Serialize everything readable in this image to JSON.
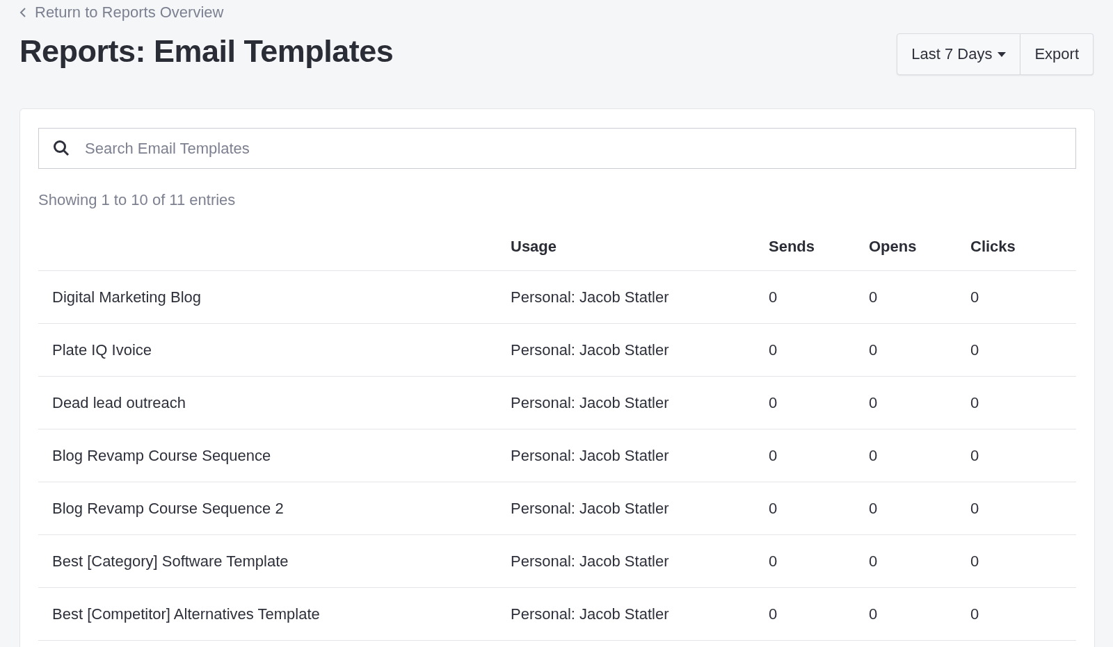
{
  "back_link": "Return to Reports Overview",
  "title": "Reports: Email Templates",
  "buttons": [
    {
      "label": "Last 7 Days",
      "kind": "dropdown"
    },
    {
      "label": "Export",
      "kind": "plain"
    }
  ],
  "search": {
    "placeholder": "Search Email Templates"
  },
  "entries_info": "Showing 1 to 10 of 11 entries",
  "table": {
    "columns": [
      "",
      "Usage",
      "Sends",
      "Opens",
      "Clicks"
    ],
    "rows": [
      [
        "Digital Marketing Blog",
        "Personal: Jacob Statler",
        "0",
        "0",
        "0"
      ],
      [
        "Plate IQ Ivoice",
        "Personal: Jacob Statler",
        "0",
        "0",
        "0"
      ],
      [
        "Dead lead outreach",
        "Personal: Jacob Statler",
        "0",
        "0",
        "0"
      ],
      [
        "Blog Revamp Course Sequence",
        "Personal: Jacob Statler",
        "0",
        "0",
        "0"
      ],
      [
        "Blog Revamp Course Sequence 2",
        "Personal: Jacob Statler",
        "0",
        "0",
        "0"
      ],
      [
        "Best [Category] Software Template",
        "Personal: Jacob Statler",
        "0",
        "0",
        "0"
      ],
      [
        "Best [Competitor] Alternatives Template",
        "Personal: Jacob Statler",
        "0",
        "0",
        "0"
      ]
    ]
  }
}
